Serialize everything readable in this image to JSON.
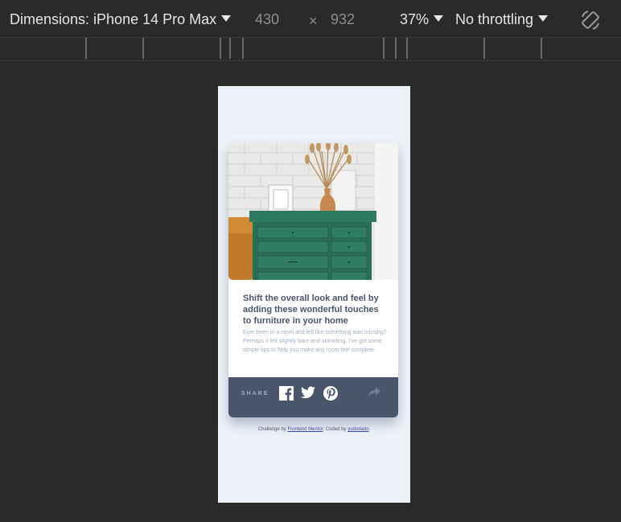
{
  "toolbar": {
    "dimensions_label": "Dimensions: iPhone 14 Pro Max",
    "width": "430",
    "times": "×",
    "height": "932",
    "zoom": "37%",
    "throttling": "No throttling",
    "rotate_icon": "rotate-icon"
  },
  "card": {
    "headline": "Shift the overall look and feel by adding these wonderful touches to furniture in your home",
    "description": "Ever been in a room and felt like something was missing? Perhaps it felt slightly bare and uninviting. I’ve got some simple tips to help you make any room feel complete.",
    "share_label": "SHARE",
    "icons": [
      "facebook-icon",
      "twitter-icon",
      "pinterest-icon",
      "share-icon"
    ]
  },
  "attribution": {
    "prefix": "Challenge by ",
    "link1": "Frontend Mentor",
    "middle": ". Coded by ",
    "link2": "yudodado",
    "suffix": "."
  },
  "colors": {
    "desktop_bg": "#2a2a2a",
    "viewport_bg": "#ecf2f8",
    "share_bar": "#48556a",
    "headline": "#48556a",
    "desc": "#9eafc2"
  }
}
